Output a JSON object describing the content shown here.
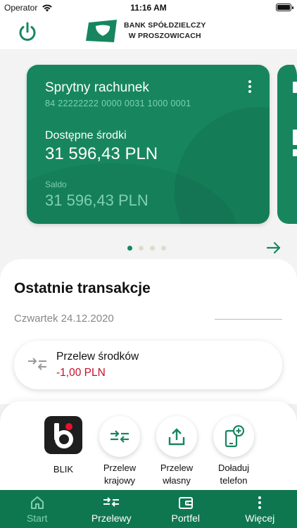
{
  "status_bar": {
    "carrier": "Operator",
    "time": "11:16 AM",
    "icons": [
      "wifi-icon",
      "battery-icon"
    ]
  },
  "header": {
    "bank_name_line1": "BANK SPÓŁDZIELCZY",
    "bank_name_line2": "W PROSZOWICACH",
    "icons": [
      "power-icon",
      "bank-logo"
    ]
  },
  "account_card": {
    "name": "Sprytny rachunek",
    "account_number": "84 22222222 0000 0031 1000 0001",
    "available_label": "Dostępne środki",
    "available_value": "31 596,43 PLN",
    "saldo_label": "Saldo",
    "saldo_value": "31 596,43 PLN"
  },
  "carousel": {
    "pages": 4,
    "active_index": 0,
    "next_icon": "arrow-right-icon"
  },
  "transactions": {
    "title": "Ostatnie transakcje",
    "date": "Czwartek 24.12.2020",
    "items": [
      {
        "title": "Przelew środków",
        "amount": "-1,00 PLN",
        "icon": "transfer-arrows-icon"
      }
    ]
  },
  "quick_actions": [
    {
      "label": "BLIK",
      "icon": "blik-logo"
    },
    {
      "label_line1": "Przelew",
      "label_line2": "krajowy",
      "icon": "transfer-arrows-icon"
    },
    {
      "label_line1": "Przelew",
      "label_line2": "własny",
      "icon": "upload-icon"
    },
    {
      "label_line1": "Doładuj",
      "label_line2": "telefon",
      "icon": "phone-topup-icon"
    }
  ],
  "bottom_nav": [
    {
      "label": "Start",
      "icon": "home-icon",
      "active": true
    },
    {
      "label": "Przelewy",
      "icon": "transfer-arrows-icon",
      "active": false
    },
    {
      "label": "Portfel",
      "icon": "wallet-icon",
      "active": false
    },
    {
      "label": "Więcej",
      "icon": "more-vertical-icon",
      "active": false
    }
  ],
  "colors": {
    "brand_green": "#17865f",
    "nav_green": "#0f7750",
    "accent_light_green": "#7fd0b0",
    "negative_red": "#c40f2a"
  }
}
